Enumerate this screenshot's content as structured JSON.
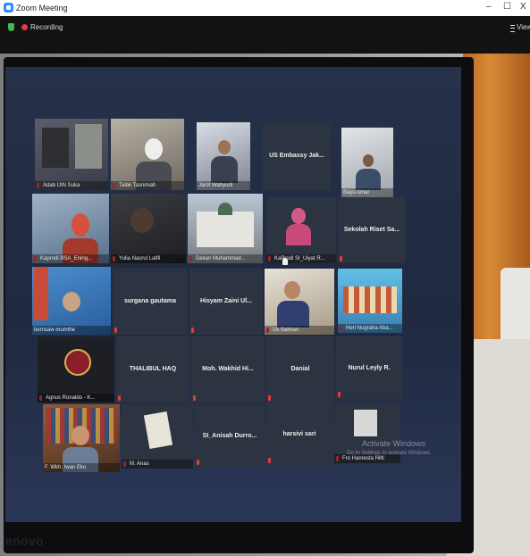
{
  "window": {
    "title": "Zoom Meeting",
    "minimize": "–",
    "maximize": "☐",
    "close": "X"
  },
  "topbar": {
    "recording_label": "Recording",
    "view_label": "View"
  },
  "monitor": {
    "brand": "enovo"
  },
  "participants": {
    "p1": "Adab UIN Suka",
    "p2": "Taibk Tasnimah",
    "p3": "Jarot Wahyudi",
    "p4": "US Embassy Jak...",
    "p5": "Bayu Amar",
    "p6": "Kaprodi BSA_Ening...",
    "p7": "Yulia Nasrul Latifi",
    "p8": "Dekan Muhammad...",
    "p9": "KaProdi SI_Uiyat R...",
    "p10": "Sekolah Riset Sa...",
    "p11": "bernsaw mumthe",
    "p12": "surgana gautama",
    "p13": "Hisyam Zaini Ul...",
    "p14": "Uk Salman",
    "p15": "Heri Nugraha Aba...",
    "p16": "Agnus Ronaldo - K...",
    "p17": "THALIBUL HAQ",
    "p18": "Moh. Wakhid Hi...",
    "p19": "Danial",
    "p20": "Nurul Leyly R.",
    "p21": "F. Wkh. Iwan Eko",
    "p22": "M. Anas",
    "p23": "SI_Anisah Durro...",
    "p24": "harsivi sari",
    "p25": "Fro Hanresta Hilti"
  },
  "activation": {
    "line1": "Activate Windows",
    "line2": "Go to Settings to activate Windows."
  },
  "colors": {
    "recording": "#e23b3b",
    "shield": "#3fb950",
    "zoom_blue": "#2d8cff",
    "tile": "#2d3441"
  }
}
